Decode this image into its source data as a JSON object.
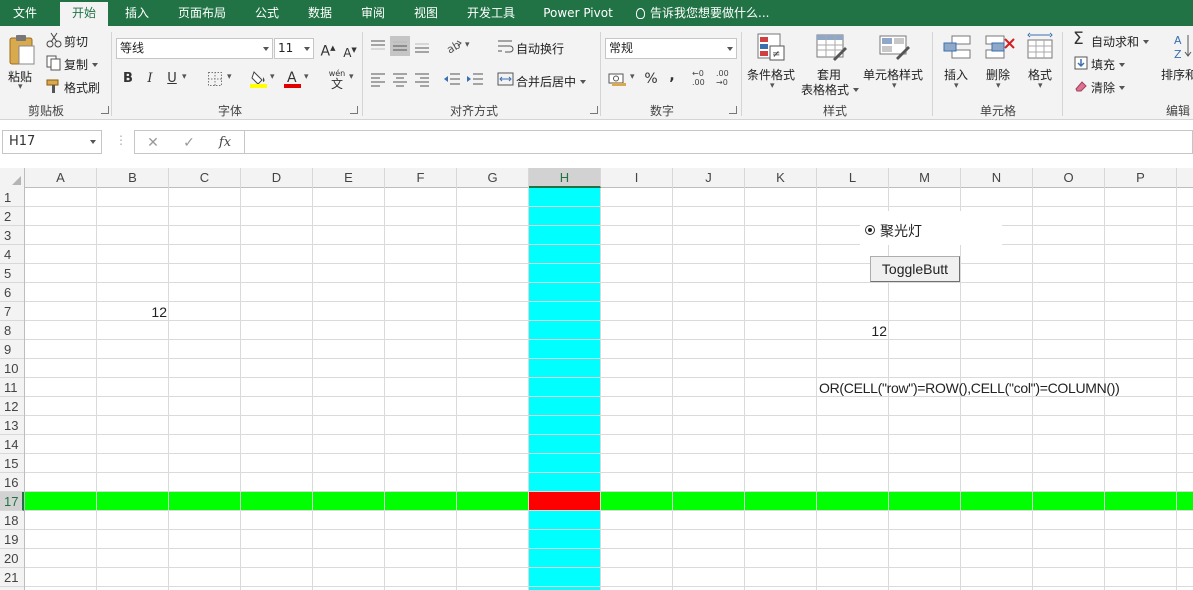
{
  "tabs": [
    "文件",
    "开始",
    "插入",
    "页面布局",
    "公式",
    "数据",
    "审阅",
    "视图",
    "开发工具",
    "Power Pivot"
  ],
  "active_tab": "开始",
  "tell_me": "告诉我您想要做什么...",
  "ribbon": {
    "clipboard": {
      "paste": "粘贴",
      "cut": "剪切",
      "copy": "复制",
      "format_painter": "格式刷",
      "label": "剪贴板"
    },
    "font": {
      "name": "等线",
      "size": "11",
      "bold": "B",
      "italic": "I",
      "underline": "U",
      "label": "字体",
      "wen": "wén",
      "wen_char": "文"
    },
    "alignment": {
      "wrap": "自动换行",
      "merge": "合并后居中",
      "label": "对齐方式"
    },
    "number": {
      "format": "常规",
      "percent": "%",
      "comma": ",",
      "inc": "←0 .00",
      "dec": ".00 →0",
      "label": "数字"
    },
    "styles": {
      "conditional": "条件格式",
      "table_line1": "套用",
      "table_line2": "表格格式",
      "cell_styles": "单元格样式",
      "label": "样式"
    },
    "cells": {
      "insert": "插入",
      "delete": "删除",
      "format": "格式",
      "label": "单元格"
    },
    "editing": {
      "autosum": "自动求和",
      "fill": "填充",
      "clear": "清除",
      "sort": "排序和",
      "label": "编辑"
    }
  },
  "formula_bar": {
    "name_box": "H17",
    "cancel": "✕",
    "enter": "✓",
    "fx": "fx",
    "formula": ""
  },
  "columns": [
    "A",
    "B",
    "C",
    "D",
    "E",
    "F",
    "G",
    "H",
    "I",
    "J",
    "K",
    "L",
    "M",
    "N",
    "O",
    "P"
  ],
  "rows": [
    "1",
    "2",
    "3",
    "4",
    "5",
    "6",
    "7",
    "8",
    "9",
    "10",
    "11",
    "12",
    "13",
    "14",
    "15",
    "16",
    "17",
    "18",
    "19",
    "20",
    "21"
  ],
  "selected_cell": {
    "column": "H",
    "row": "17"
  },
  "cells": {
    "B7": "12",
    "L8": "12",
    "L11": "OR(CELL(\"row\")=ROW(),CELL(\"col\")=COLUMN())"
  },
  "highlight_colors": {
    "column": "#00ffff",
    "row": "#00ff00",
    "intersection": "#ff0000",
    "accent": "#217346"
  },
  "controls": {
    "radio_label": "聚光灯",
    "toggle_label": "ToggleButt"
  }
}
